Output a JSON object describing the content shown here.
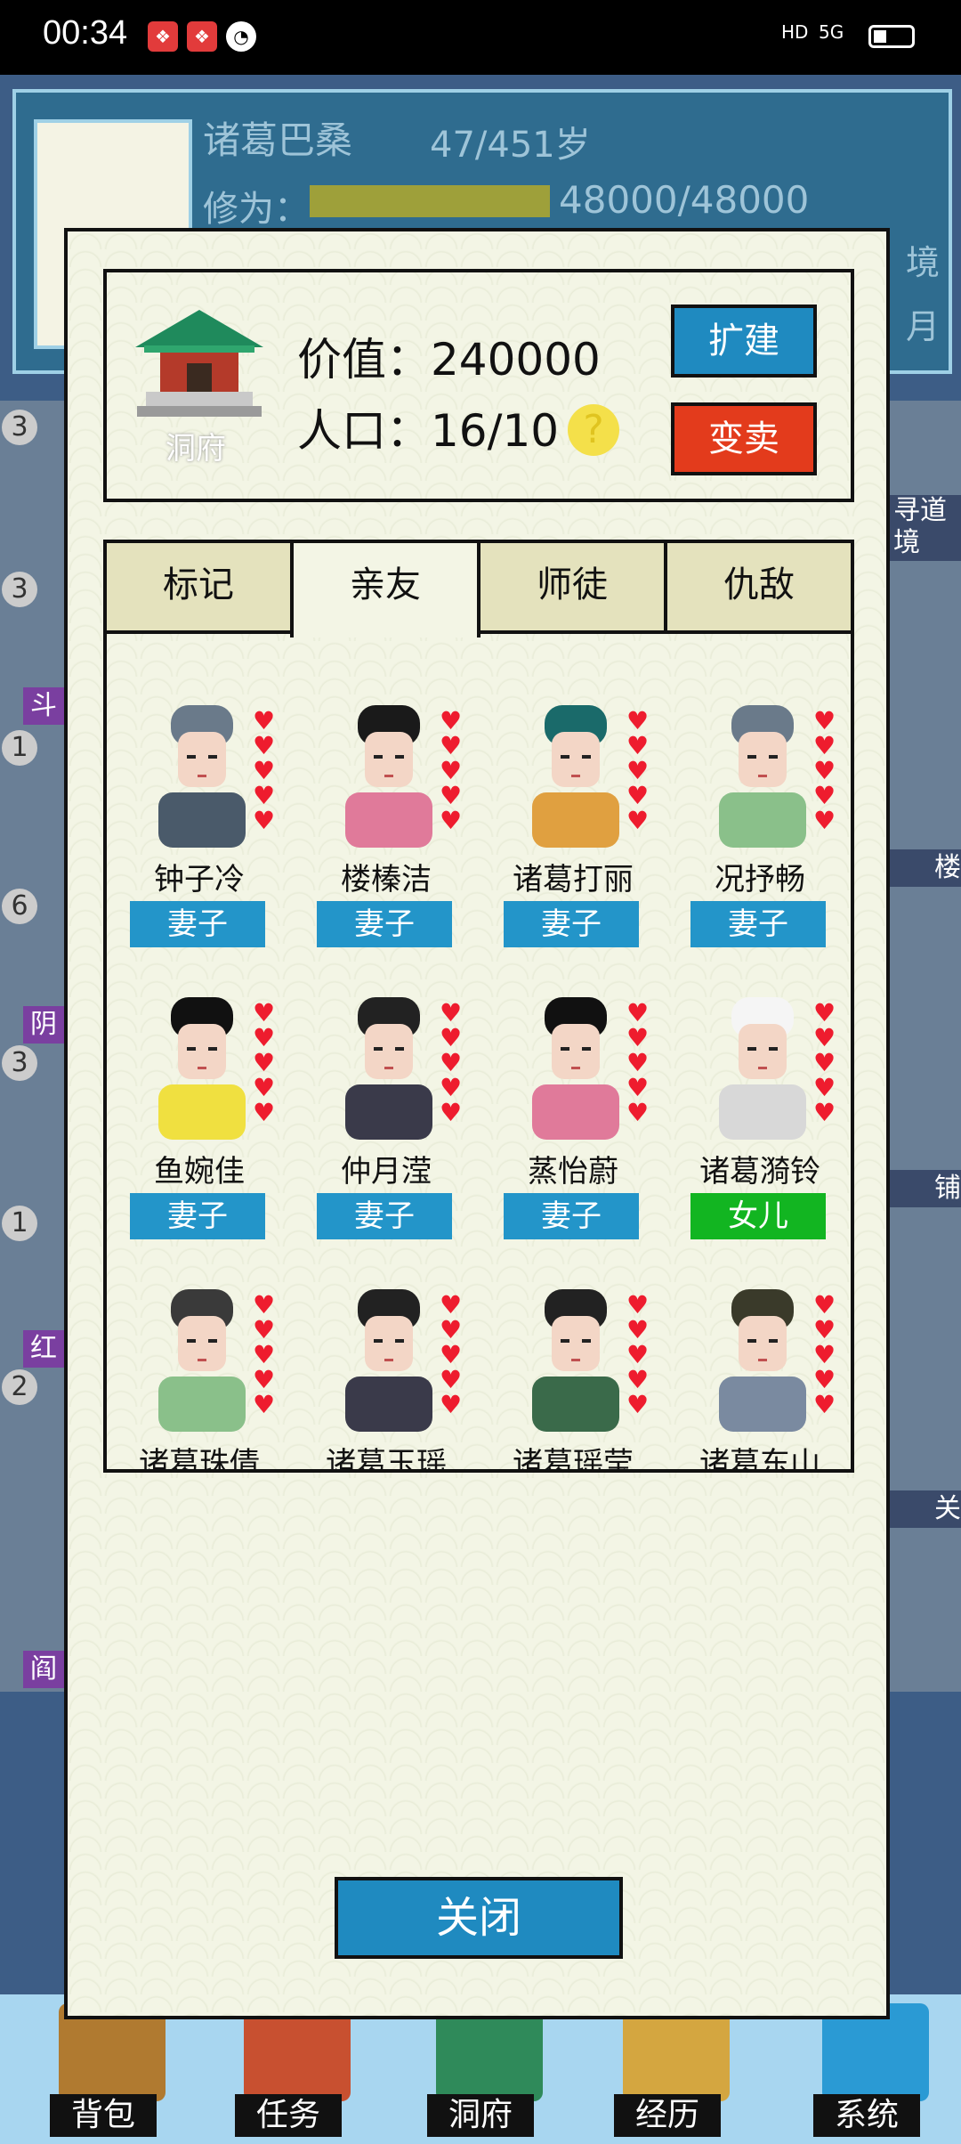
{
  "status": {
    "time": "00:34",
    "network": "5G",
    "hd": "HD"
  },
  "player": {
    "name": "诸葛巴桑",
    "age": "47/451岁",
    "cultivation_label": "修为：",
    "cultivation_value": "48000/48000",
    "cultivation_progress": 1.0,
    "realm_suffix": "境",
    "month_suffix": "月"
  },
  "cave": {
    "label": "洞府",
    "value_label": "价值：",
    "value": "240000",
    "population_label": "人口：",
    "population": "16/10",
    "help": "?",
    "expand_button": "扩建",
    "sell_button": "变卖"
  },
  "tabs": [
    {
      "label": "标记",
      "active": false
    },
    {
      "label": "亲友",
      "active": true
    },
    {
      "label": "师徒",
      "active": false
    },
    {
      "label": "仇敌",
      "active": false
    }
  ],
  "members": [
    {
      "name": "钟子冷",
      "relation": "妻子",
      "relation_color": "#2395c9",
      "hearts": 5
    },
    {
      "name": "楼榛洁",
      "relation": "妻子",
      "relation_color": "#2395c9",
      "hearts": 5
    },
    {
      "name": "诸葛打丽",
      "relation": "妻子",
      "relation_color": "#2395c9",
      "hearts": 5
    },
    {
      "name": "况抒畅",
      "relation": "妻子",
      "relation_color": "#2395c9",
      "hearts": 5
    },
    {
      "name": "鱼婉佳",
      "relation": "妻子",
      "relation_color": "#2395c9",
      "hearts": 5
    },
    {
      "name": "仲月滢",
      "relation": "妻子",
      "relation_color": "#2395c9",
      "hearts": 5
    },
    {
      "name": "蒸怡蔚",
      "relation": "妻子",
      "relation_color": "#2395c9",
      "hearts": 5
    },
    {
      "name": "诸葛漪铃",
      "relation": "女儿",
      "relation_color": "#12b521",
      "hearts": 5
    },
    {
      "name": "诸葛珠倩",
      "relation": "",
      "relation_color": "#2395c9",
      "hearts": 5
    },
    {
      "name": "诸葛玉瑶",
      "relation": "",
      "relation_color": "#2395c9",
      "hearts": 5
    },
    {
      "name": "诸葛瑶莹",
      "relation": "",
      "relation_color": "#2395c9",
      "hearts": 5
    },
    {
      "name": "诸葛东山",
      "relation": "",
      "relation_color": "#2395c9",
      "hearts": 5
    }
  ],
  "close_button": "关闭",
  "background_side": {
    "left_numbers": [
      "3",
      "3",
      "1",
      "6",
      "3",
      "1",
      "2"
    ],
    "left_tags": [
      "斗",
      "阴",
      "红",
      "阎"
    ],
    "right_tags": [
      "寻道境",
      "楼",
      "铺",
      "关"
    ]
  },
  "nav": [
    {
      "label": "背包"
    },
    {
      "label": "任务"
    },
    {
      "label": "洞府"
    },
    {
      "label": "经历"
    },
    {
      "label": "系统"
    }
  ]
}
